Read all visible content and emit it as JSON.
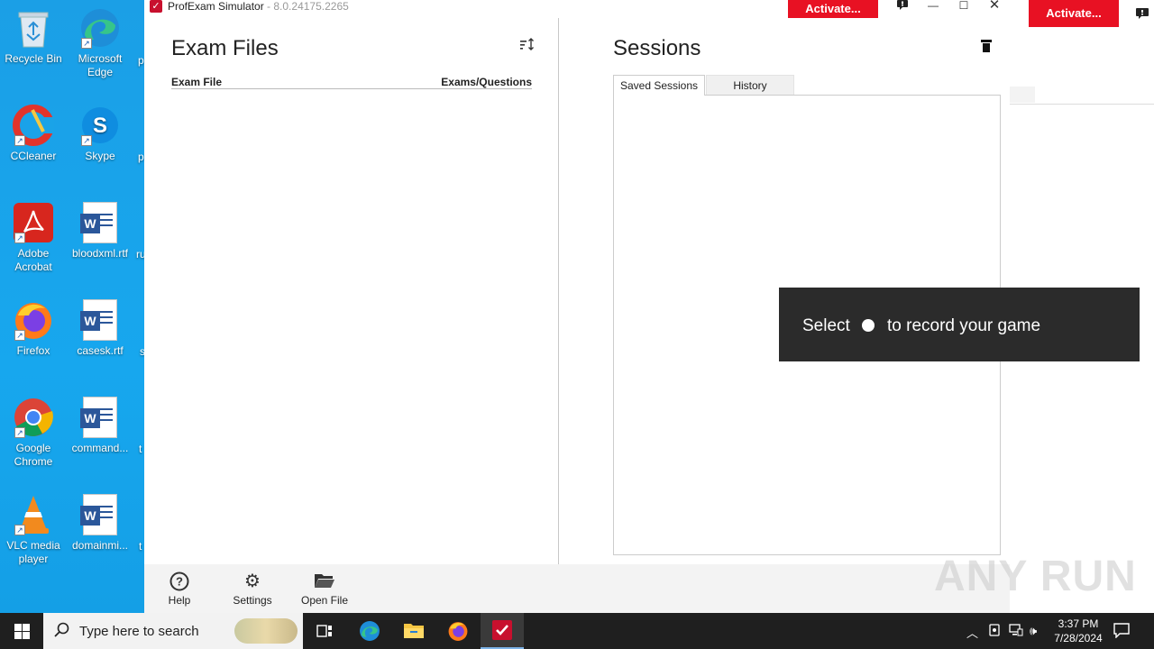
{
  "desktop": {
    "icons": [
      {
        "label": "Recycle Bin"
      },
      {
        "label": "Microsoft Edge"
      },
      {
        "label": "CCleaner"
      },
      {
        "label": "Skype"
      },
      {
        "label": "Adobe Acrobat"
      },
      {
        "label": "bloodxml.rtf"
      },
      {
        "label": "Firefox"
      },
      {
        "label": "casesk.rtf"
      },
      {
        "label": "Google Chrome"
      },
      {
        "label": "command..."
      },
      {
        "label": "VLC media player"
      },
      {
        "label": "domainmi..."
      }
    ],
    "clipped_labels": [
      "p",
      "p",
      "ru",
      "s",
      "t",
      "t"
    ]
  },
  "app": {
    "title": "ProfExam Simulator",
    "version": "- 8.0.24175.2265",
    "activate_label": "Activate...",
    "exam_files": {
      "title": "Exam Files",
      "col_file": "Exam File",
      "col_questions": "Exams/Questions"
    },
    "sessions": {
      "title": "Sessions",
      "tabs": [
        {
          "label": "Saved Sessions"
        },
        {
          "label": "History"
        }
      ],
      "active_tab": 0
    },
    "toolbar": [
      {
        "label": "Help",
        "icon": "help-icon"
      },
      {
        "label": "Settings",
        "icon": "gear-icon"
      },
      {
        "label": "Open File",
        "icon": "folder-open-icon"
      }
    ]
  },
  "second_window": {
    "activate_label": "Activate..."
  },
  "toast": {
    "text_before": "Select",
    "text_after": "to record your game"
  },
  "watermark": "ANY RUN",
  "taskbar": {
    "search_placeholder": "Type here to search",
    "time": "3:37 PM",
    "date": "7/28/2024"
  },
  "colors": {
    "accent_red": "#e81123",
    "desktop_blue": "#1aa3e8",
    "taskbar": "#1f1f1f"
  }
}
